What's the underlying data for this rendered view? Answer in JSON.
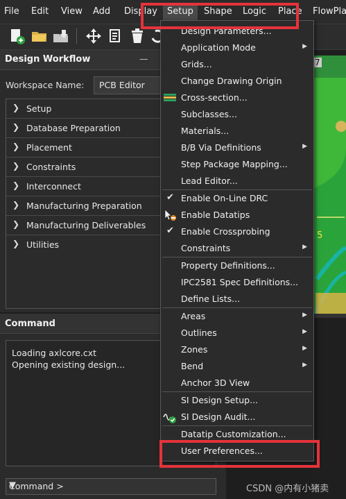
{
  "menubar": {
    "items": [
      {
        "label": "File"
      },
      {
        "label": "Edit"
      },
      {
        "label": "View"
      },
      {
        "label": "Add"
      },
      {
        "label": "Display"
      },
      {
        "label": "Setup"
      },
      {
        "label": "Shape"
      },
      {
        "label": "Logic"
      },
      {
        "label": "Place"
      },
      {
        "label": "FlowPlan"
      }
    ]
  },
  "design_workflow": {
    "title": "Design Workflow",
    "pin_glyph": "—",
    "workspace_label": "Workspace Name:",
    "workspace_value": "PCB Editor",
    "items": [
      {
        "label": "Setup"
      },
      {
        "label": "Database Preparation"
      },
      {
        "label": "Placement"
      },
      {
        "label": "Constraints"
      },
      {
        "label": "Interconnect"
      },
      {
        "label": "Manufacturing Preparation"
      },
      {
        "label": "Manufacturing Deliverables"
      },
      {
        "label": "Utilities"
      }
    ]
  },
  "command_panel": {
    "title": "Command",
    "log": [
      "Loading axlcore.cxt",
      "Opening existing design..."
    ],
    "input_label": "Command >"
  },
  "setup_menu": {
    "items": [
      {
        "label": "Design Parameters..."
      },
      {
        "label": "Application Mode"
      },
      {
        "label": "Grids..."
      },
      {
        "label": "Change Drawing Origin"
      },
      {
        "label": "Cross-section..."
      },
      {
        "label": "Subclasses..."
      },
      {
        "label": "Materials..."
      },
      {
        "label": "B/B Via Definitions"
      },
      {
        "label": "Step Package Mapping..."
      },
      {
        "label": "Lead Editor..."
      },
      {
        "label": "Enable On-Line DRC"
      },
      {
        "label": "Enable Datatips"
      },
      {
        "label": "Enable Crossprobing"
      },
      {
        "label": "Constraints"
      },
      {
        "label": "Property Definitions..."
      },
      {
        "label": "IPC2581 Spec Definitions..."
      },
      {
        "label": "Define Lists..."
      },
      {
        "label": "Areas"
      },
      {
        "label": "Outlines"
      },
      {
        "label": "Zones"
      },
      {
        "label": "Bend"
      },
      {
        "label": "Anchor 3D View"
      },
      {
        "label": "SI Design Setup..."
      },
      {
        "label": "SI Design Audit..."
      },
      {
        "label": "Datatip Customization..."
      },
      {
        "label": "User Preferences..."
      }
    ],
    "arrow_glyph": "▶",
    "check_glyph": "✔"
  },
  "canvas": {
    "labels": [
      "7",
      "5"
    ]
  },
  "watermark": "CSDN @内有小猪卖",
  "colors": {
    "highlight": "#e5333a",
    "pcb_green": "#3fb83a",
    "teal": "#19b3a6"
  },
  "icons": [
    "new-design-icon",
    "open-folder-icon",
    "save-icon",
    "move-icon",
    "copy-icon",
    "delete-icon",
    "undo-icon",
    "cross-section-icon",
    "datatip-icon",
    "si-audit-icon",
    "chevron-right-icon",
    "dropdown-arrow-icon"
  ]
}
